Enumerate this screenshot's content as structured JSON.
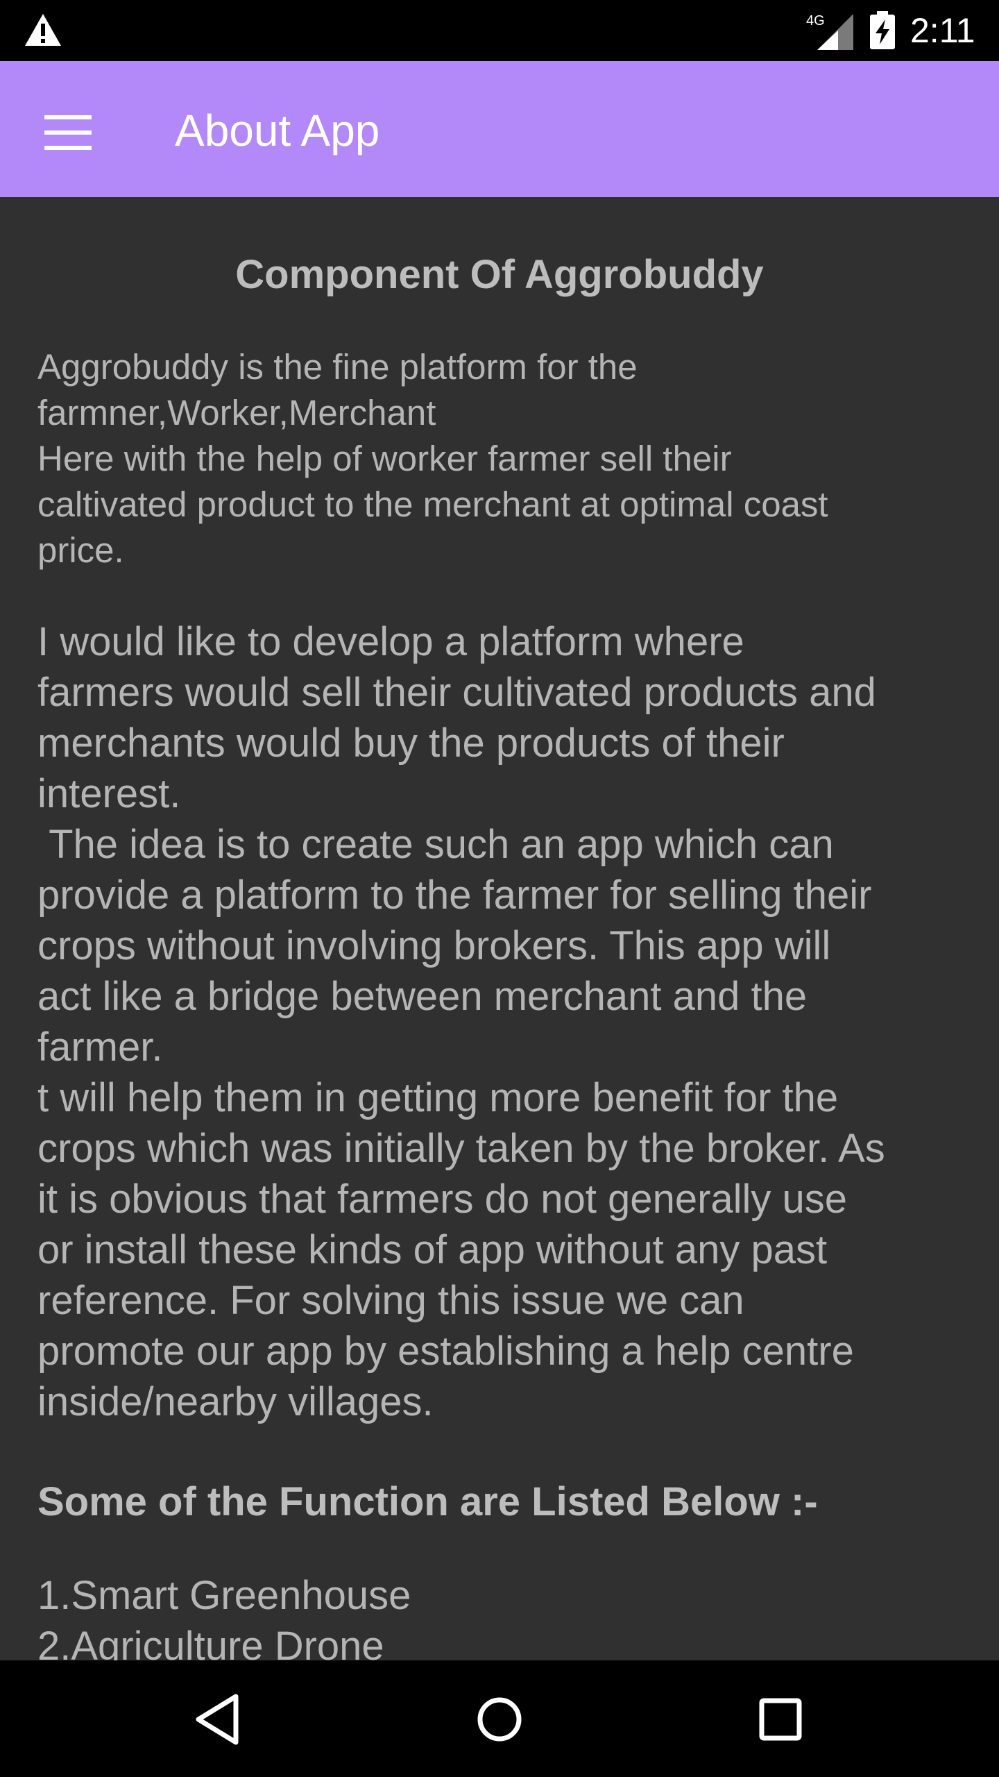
{
  "status_bar": {
    "time": "2:11",
    "network": "4G",
    "icons": [
      "warning-icon",
      "signal-icon",
      "battery-charging-icon"
    ]
  },
  "app_bar": {
    "title": "About App",
    "menu_icon": "hamburger-menu-icon",
    "color": "#b388f8"
  },
  "content": {
    "heading": "Component Of Aggrobuddy",
    "intro": "Aggrobuddy is the fine platform for the\nfarmner,Worker,Merchant\nHere with the help of worker farmer sell their\ncaltivated product to the merchant at optimal coast\nprice.",
    "body": "I would like to develop a platform where\nfarmers would sell their cultivated products and\nmerchants would buy the products of their\ninterest.\n The idea is to create such an app which can\nprovide a platform to the farmer for selling their\ncrops without involving brokers. This app will\nact like a bridge between merchant and the\nfarmer.\nt will help them in getting more benefit for the\ncrops which was initially taken by the broker. As\nit is obvious that farmers do not generally use\nor install these kinds of app without any past\nreference. For solving this issue we can\npromote our app by establishing a help centre\ninside/nearby villages.",
    "functions_heading": "Some of the Function are Listed Below :-",
    "functions": [
      "1.Smart Greenhouse",
      "2.Agriculture Drone"
    ]
  },
  "nav_bar": {
    "buttons": [
      "back-icon",
      "home-icon",
      "recents-icon"
    ]
  },
  "colors": {
    "background": "#303030",
    "text": "#b5b5b5"
  }
}
